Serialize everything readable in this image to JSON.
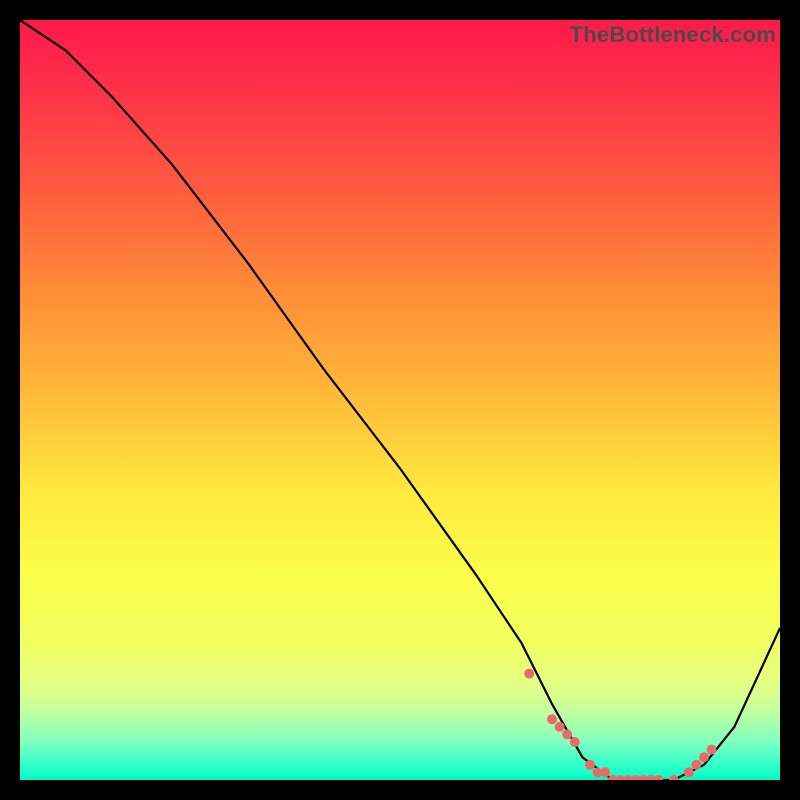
{
  "watermark": "TheBottleneck.com",
  "chart_data": {
    "type": "line",
    "title": "",
    "xlabel": "",
    "ylabel": "",
    "xlim": [
      0,
      100
    ],
    "ylim": [
      0,
      100
    ],
    "series": [
      {
        "name": "curve",
        "x": [
          0,
          6,
          12,
          20,
          30,
          40,
          50,
          60,
          66,
          70,
          74,
          78,
          82,
          86,
          90,
          94,
          100
        ],
        "y": [
          100,
          96,
          90,
          81,
          68,
          54,
          41,
          27,
          18,
          10,
          3,
          0,
          0,
          0,
          2,
          7,
          20
        ]
      }
    ],
    "markers": {
      "x": [
        67,
        70,
        71,
        72,
        73,
        75,
        76,
        77,
        78,
        79,
        80,
        81,
        82,
        83,
        84,
        86,
        88,
        89,
        90,
        91
      ],
      "y": [
        14,
        8,
        7,
        6,
        5,
        2,
        1,
        1,
        0,
        0,
        0,
        0,
        0,
        0,
        0,
        0,
        1,
        2,
        3,
        4
      ]
    },
    "background": "vertical-gradient red→yellow→green",
    "grid": false
  }
}
